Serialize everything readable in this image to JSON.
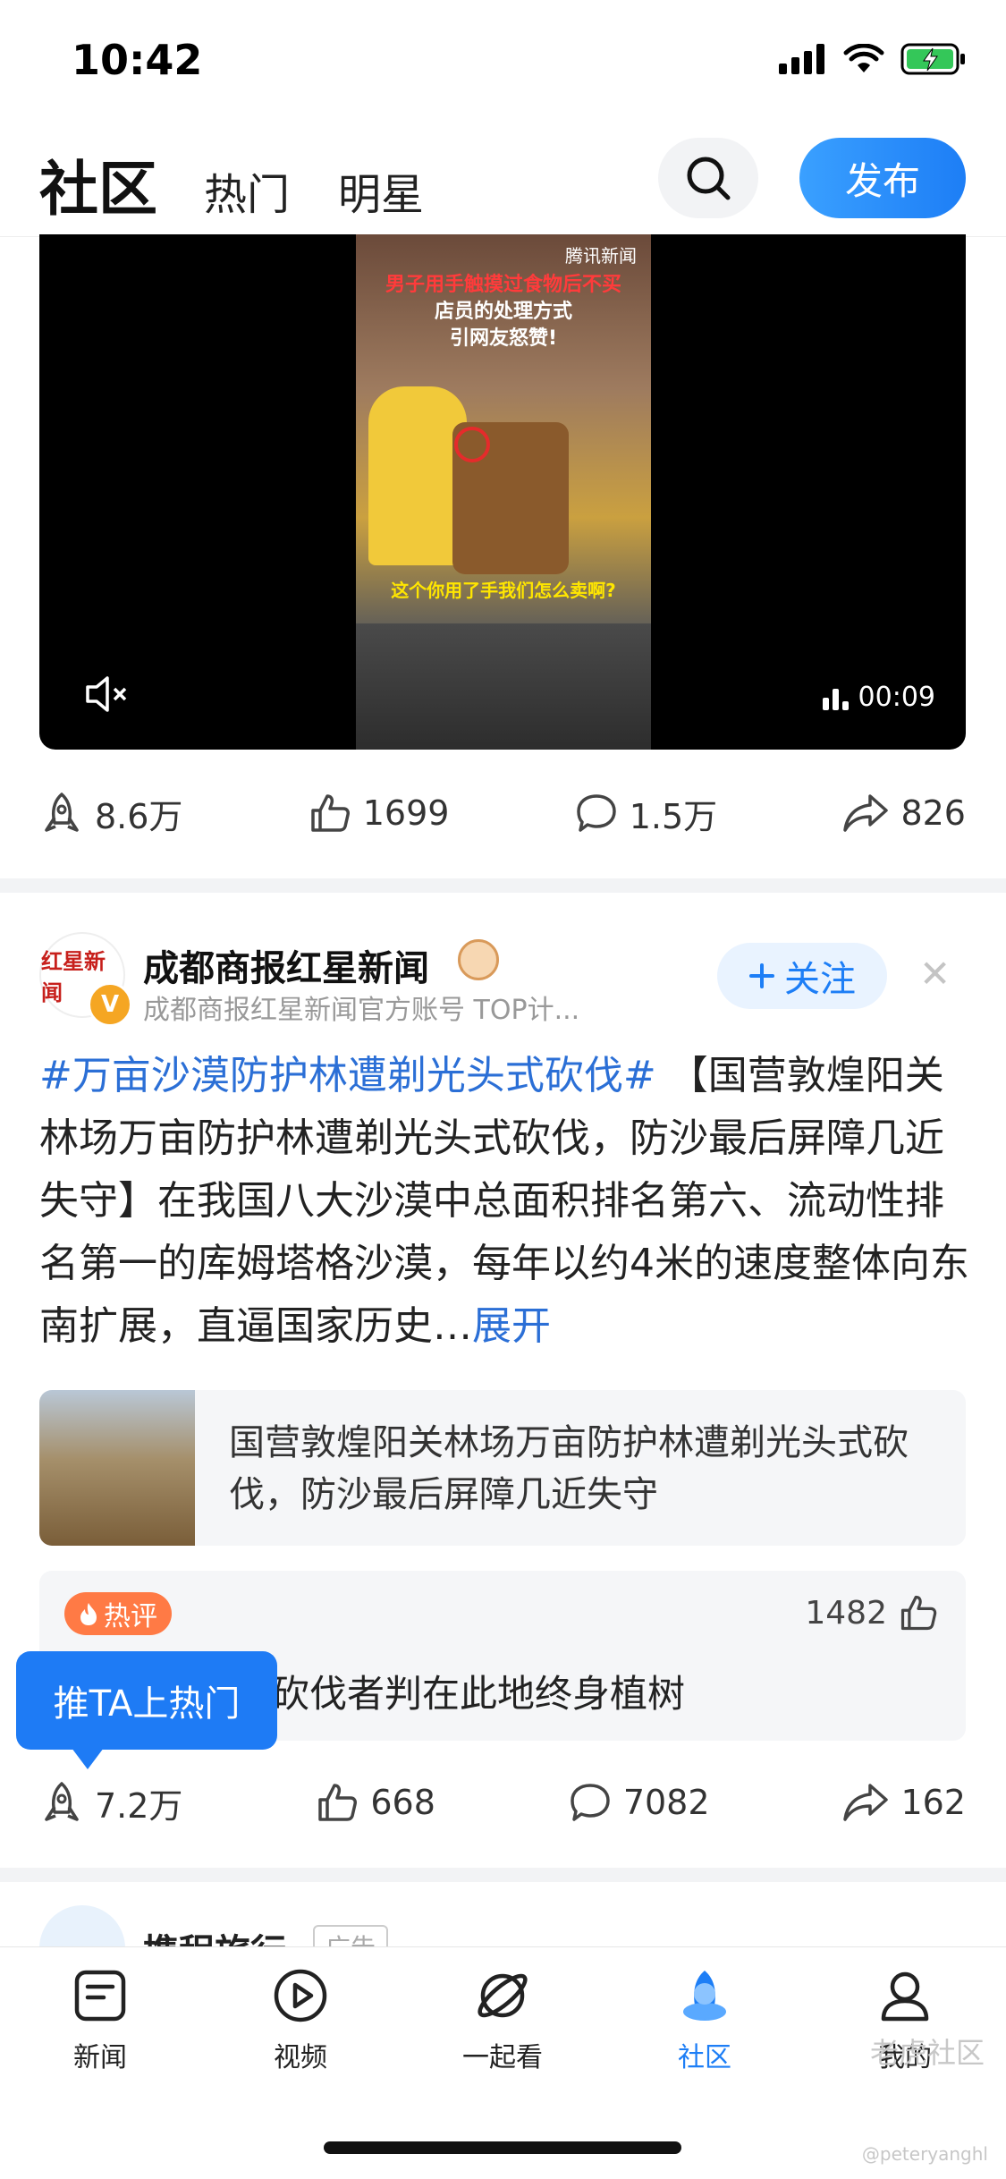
{
  "status_bar": {
    "time": "10:42"
  },
  "header": {
    "title": "社区",
    "tabs": [
      "热门",
      "明星"
    ],
    "publish_label": "发布"
  },
  "video_post": {
    "source_logo": "腾讯新闻",
    "headline_line1": "男子用手触摸过食物后不买",
    "headline_line2": "店员的处理方式",
    "headline_line3": "引网友怒赞!",
    "caption": "这个你用了手我们怎么卖啊?",
    "duration": "00:09",
    "stats": {
      "views": "8.6万",
      "likes": "1699",
      "comments": "1.5万",
      "shares": "826"
    }
  },
  "post": {
    "avatar_text": "红星新闻",
    "author": "成都商报红星新闻",
    "author_sub": "成都商报红星新闻官方账号 TOP计...",
    "follow_label": "关注",
    "hashtag": "#万亩沙漠防护林遭剃光头式砍伐#",
    "body": "【国营敦煌阳关林场万亩防护林遭剃光头式砍伐，防沙最后屏障几近失守】在我国八大沙漠中总面积排名第六、流动性排名第一的库姆塔格沙漠，每年以约4米的速度整体向东南扩展，直逼国家历史…",
    "expand_label": "展开",
    "link_title": "国营敦煌阳关林场万亩防护林遭剃光头式砍伐，防沙最后屏障几近失守",
    "hot_badge": "热评",
    "hot_likes": "1482",
    "hot_comment": "砍伐者判在此地终身植树",
    "push_tip": "推TA上热门",
    "stats": {
      "views": "7.2万",
      "likes": "668",
      "comments": "7082",
      "shares": "162"
    }
  },
  "next_post": {
    "author": "携程旅行",
    "ad_label": "广告"
  },
  "bottom_nav": [
    {
      "label": "新闻"
    },
    {
      "label": "视频"
    },
    {
      "label": "一起看"
    },
    {
      "label": "社区"
    },
    {
      "label": "我的"
    }
  ],
  "watermark": {
    "main": "老虎社区",
    "sub": "@peteryanghl"
  },
  "colors": {
    "accent": "#1d7ef6",
    "hot": "#ff7a45",
    "link": "#2b6fd6"
  }
}
